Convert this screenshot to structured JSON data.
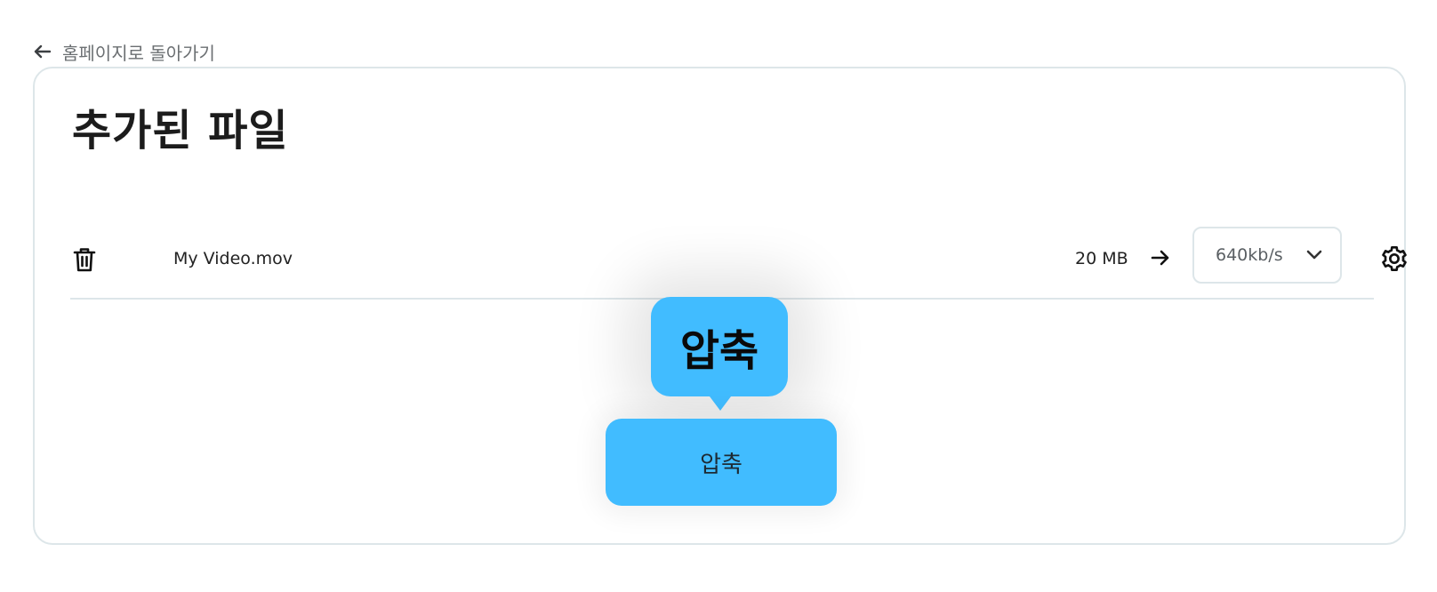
{
  "back_link": {
    "label": "홈페이지로 돌아가기",
    "icon": "arrow-left-icon"
  },
  "card": {
    "title": "추가된 파일",
    "files": [
      {
        "name": "My Video.mov",
        "size": "20 MB",
        "bitrate": "640kb/s",
        "icons": {
          "delete": "trash-icon",
          "arrow": "arrow-right-icon",
          "dropdown": "chevron-down-icon",
          "settings": "gear-icon"
        }
      }
    ],
    "tooltip": "압축",
    "compress_button": "압축"
  },
  "colors": {
    "accent": "#41bcff",
    "border": "#dde6e9",
    "text": "#1c1c1c",
    "muted": "#6b6f72"
  }
}
